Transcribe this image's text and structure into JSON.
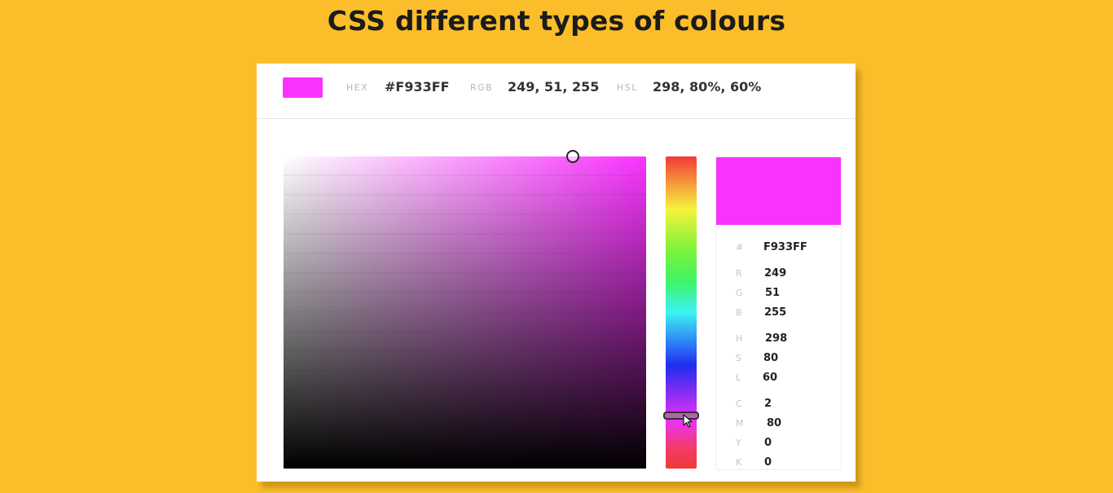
{
  "page": {
    "title": "CSS different types of colours"
  },
  "colors": {
    "selected": "#F933FF",
    "background": "#FBBE2A"
  },
  "topbar": {
    "hex_label": "HEX",
    "hex_value": "#F933FF",
    "rgb_label": "RGB",
    "rgb_value": "249, 51, 255",
    "hsl_label": "HSL",
    "hsl_value": "298, 80%, 60%"
  },
  "picker": {
    "hue_slider_level": 0.83
  },
  "details": {
    "hex_key": "#",
    "hex_value": "F933FF",
    "r_key": "R",
    "r_value": "249",
    "g_key": "G",
    "g_value": "51",
    "b_key": "B",
    "b_value": "255",
    "h_key": "H",
    "h_value": "298",
    "s_key": "S",
    "s_value": "80",
    "l_key": "L",
    "l_value": "60",
    "c_key": "C",
    "c_value": "2",
    "m_key": "M",
    "m_value": "80",
    "y_key": "Y",
    "y_value": "0",
    "k_key": "K",
    "k_value": "0"
  },
  "icons": {
    "cursor": "mouse-pointer-icon",
    "sv_handle": "circle-handle-icon"
  }
}
